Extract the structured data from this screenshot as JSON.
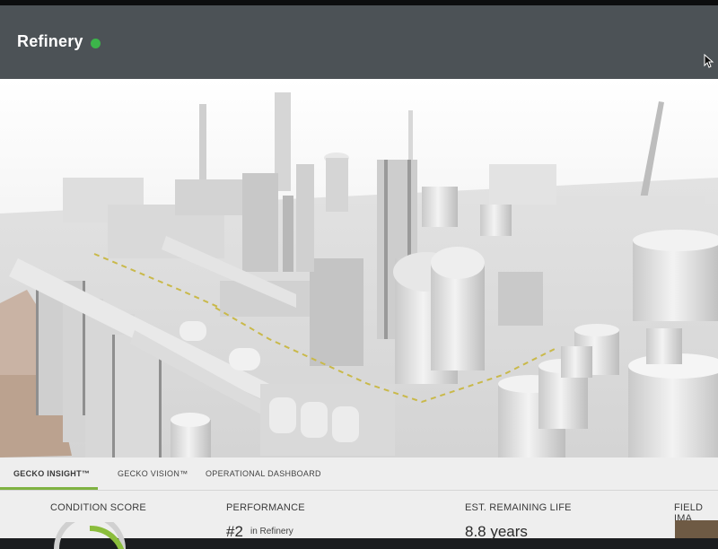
{
  "app": {
    "title": "Refinery",
    "status_color": "#3cb54a"
  },
  "tabs": [
    {
      "label": "GECKO INSIGHT™",
      "active": true
    },
    {
      "label": "GECKO VISION™",
      "active": false
    },
    {
      "label": "OPERATIONAL DASHBOARD",
      "active": false
    }
  ],
  "metrics": {
    "condition_score": {
      "label": "CONDITION SCORE"
    },
    "performance": {
      "label": "PERFORMANCE",
      "value": "#2",
      "sub": "in Refinery"
    },
    "remaining_life": {
      "label": "EST. REMAINING LIFE",
      "value": "8.8 years"
    },
    "field_images": {
      "label": "FIELD IMA"
    }
  },
  "colors": {
    "accent": "#7fb241",
    "header": "#4c5256"
  },
  "icons": {
    "cursor": "cursor-icon",
    "status": "status-dot"
  }
}
